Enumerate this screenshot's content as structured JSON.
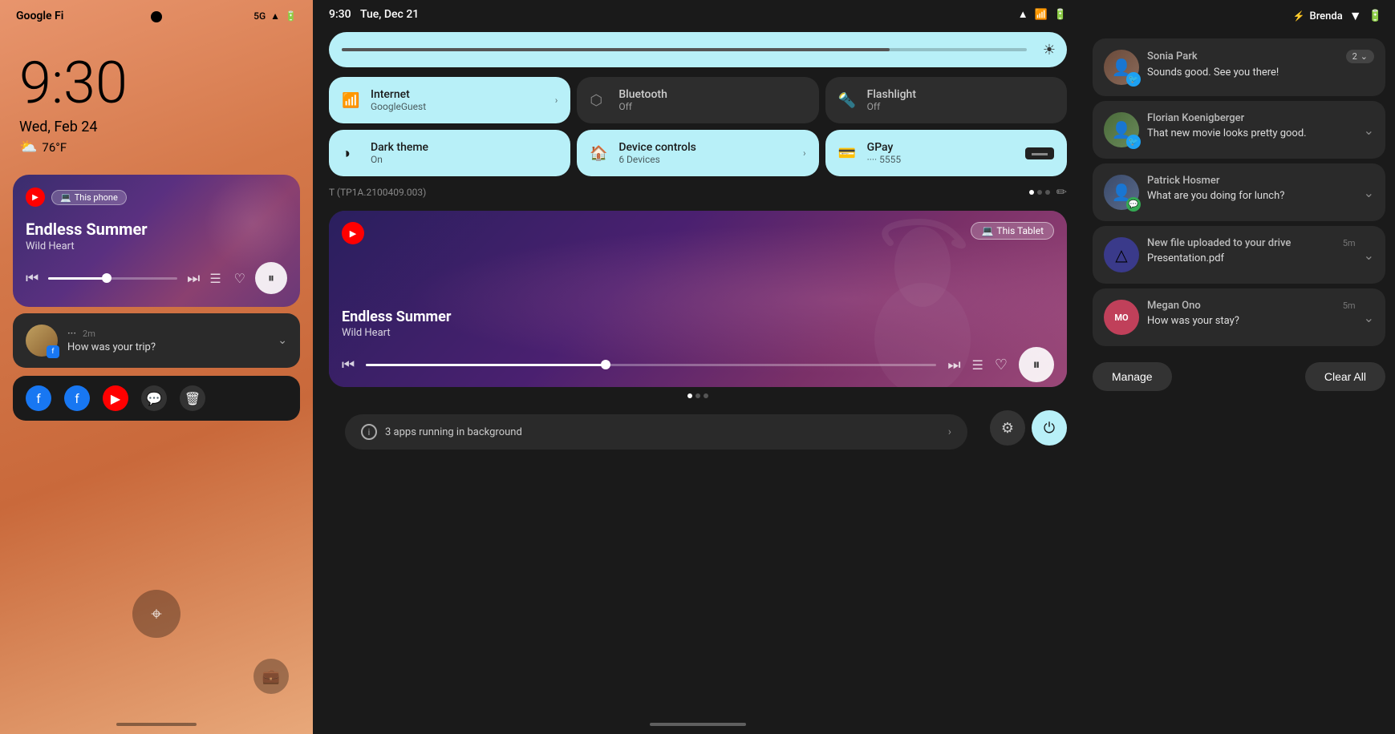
{
  "phone": {
    "carrier": "Google Fi",
    "network": "5G",
    "time": "9:30",
    "date": "Wed, Feb 24",
    "weather": "76°F",
    "music": {
      "title": "Endless Summer",
      "artist": "Wild Heart",
      "device": "This phone"
    },
    "notification": {
      "time": "2m",
      "message": "How was your trip?"
    }
  },
  "quicksettings": {
    "time": "9:30",
    "date": "Tue, Dec 21",
    "brightness_pct": 80,
    "tiles": [
      {
        "label": "Internet",
        "sublabel": "GoogleGuest",
        "active": true,
        "icon": "📶"
      },
      {
        "label": "Bluetooth",
        "sublabel": "Off",
        "active": false,
        "icon": "🔵"
      },
      {
        "label": "Flashlight",
        "sublabel": "Off",
        "active": false,
        "icon": "🔦"
      }
    ],
    "tiles2": [
      {
        "label": "Dark theme",
        "sublabel": "On",
        "active": true,
        "icon": "◑"
      },
      {
        "label": "Device controls",
        "sublabel": "6 Devices",
        "active": true,
        "icon": "🏠",
        "arrow": true
      },
      {
        "label": "GPay",
        "sublabel": "···· 5555",
        "active": true,
        "icon": "💳"
      }
    ],
    "device_info": "T (TP1A.2100409.003)",
    "music": {
      "title": "Endless Summer",
      "artist": "Wild Heart",
      "device": "This Tablet"
    },
    "bg_apps": "3 apps running in background",
    "dots": [
      true,
      false,
      false
    ],
    "music_dots": [
      true,
      false,
      false
    ]
  },
  "notifications": {
    "user": "Brenda",
    "items": [
      {
        "name": "Sonia Park",
        "message": "Sounds good. See you there!",
        "badge": "2",
        "app": "twitter"
      },
      {
        "name": "Florian Koenigberger",
        "message": "That new movie looks pretty good.",
        "app": "twitter"
      },
      {
        "name": "Patrick Hosmer",
        "message": "What are you doing for lunch?",
        "app": "messages"
      }
    ],
    "drive": {
      "title": "New file uploaded to your drive",
      "time": "5m",
      "subtitle": "Presentation.pdf"
    },
    "megan": {
      "name": "Megan Ono",
      "time": "5m",
      "message": "How was your stay?",
      "initials": "MO"
    },
    "manage_label": "Manage",
    "clear_all_label": "Clear All"
  }
}
